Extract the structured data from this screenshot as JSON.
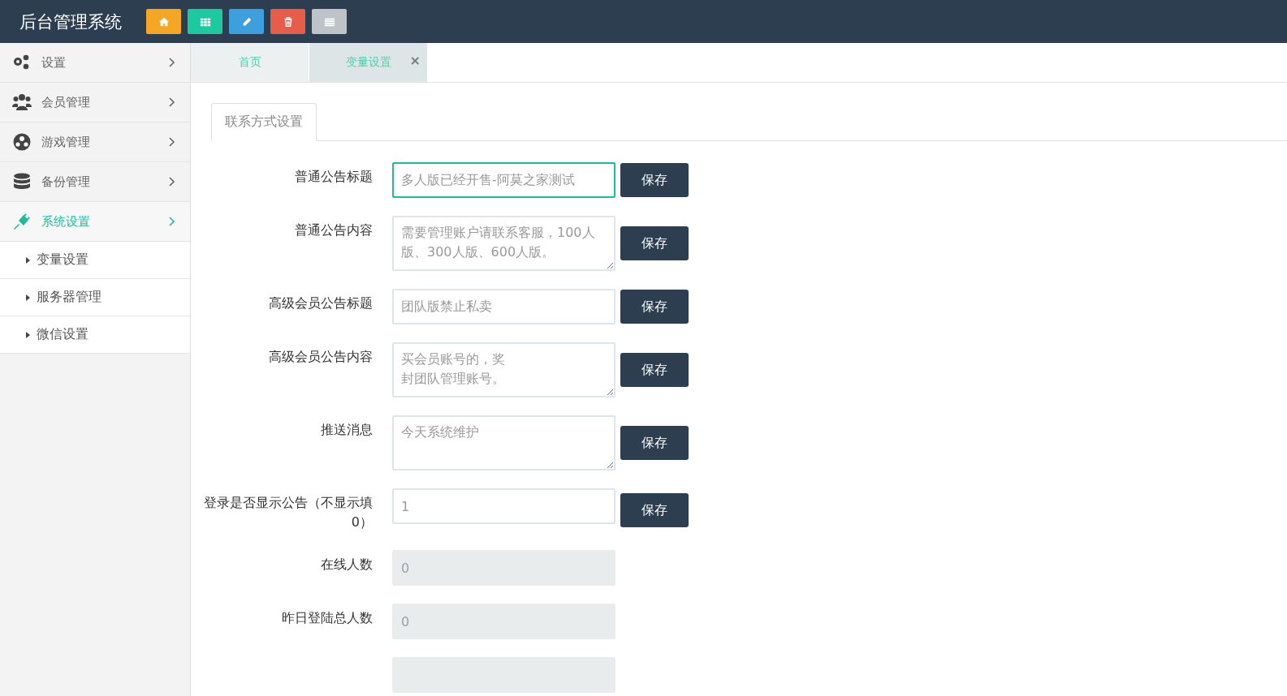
{
  "header": {
    "title": "后台管理系统",
    "tools": [
      {
        "color": "#f5a623"
      },
      {
        "color": "#1dcaa0"
      },
      {
        "color": "#3e9fde"
      },
      {
        "color": "#e85c4a"
      },
      {
        "color": "#bdc3c7"
      }
    ]
  },
  "sidebar": {
    "items": [
      {
        "label": "设置",
        "selected": false
      },
      {
        "label": "会员管理",
        "selected": false
      },
      {
        "label": "游戏管理",
        "selected": false
      },
      {
        "label": "备份管理",
        "selected": false
      },
      {
        "label": "系统设置",
        "selected": true,
        "children": [
          {
            "label": "变量设置"
          },
          {
            "label": "服务器管理"
          },
          {
            "label": "微信设置"
          }
        ]
      }
    ]
  },
  "tabs": [
    {
      "label": "首页",
      "selected": false,
      "close": false
    },
    {
      "label": "变量设置",
      "selected": true,
      "close": "×"
    }
  ],
  "section_tab": "联系方式设置",
  "form": [
    {
      "kind": "input",
      "label": "普通公告标题",
      "value": "多人版已经开售-阿莫之家测试",
      "focused": true,
      "button": "保存"
    },
    {
      "kind": "textarea",
      "label": "普通公告内容",
      "value": "需要管理账户请联系客服，100人版、300人版、600人版。",
      "focused": false,
      "button": "保存"
    },
    {
      "kind": "input",
      "label": "高级会员公告标题",
      "value": "团队版禁止私卖",
      "focused": false,
      "button": "保存"
    },
    {
      "kind": "textarea",
      "label": "高级会员公告内容",
      "lines": [
        "买会员账号的，奖",
        "封团队管理账号。"
      ],
      "focused": false,
      "button": "保存"
    },
    {
      "kind": "textarea",
      "label": "推送消息",
      "value": "今天系统维护",
      "focused": false,
      "button": "保存"
    },
    {
      "kind": "input",
      "label": "登录是否显示公告（不显示填0）",
      "value": "1",
      "focused": false,
      "button": "保存"
    },
    {
      "kind": "disabled",
      "label": "在线人数",
      "value": "0"
    },
    {
      "kind": "disabled",
      "label": "昨日登陆总人数",
      "value": "0"
    },
    {
      "kind": "disabled"
    }
  ]
}
